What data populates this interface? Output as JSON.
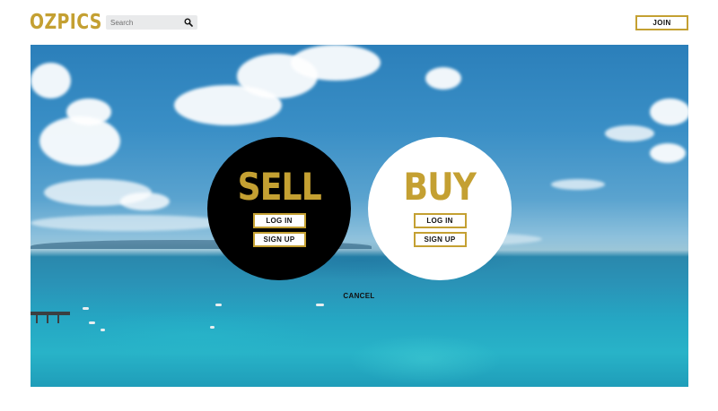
{
  "header": {
    "logo": "OZPICS",
    "search": {
      "placeholder": "Search",
      "value": ""
    },
    "join_label": "JOIN"
  },
  "modal": {
    "sell": {
      "title": "SELL",
      "login_label": "LOG IN",
      "signup_label": "SIGN UP"
    },
    "buy": {
      "title": "BUY",
      "login_label": "LOG IN",
      "signup_label": "SIGN UP"
    },
    "cancel_label": "CANCEL"
  },
  "colors": {
    "accent_gold": "#c4a032",
    "sell_circle": "#000000",
    "buy_circle": "#ffffff",
    "search_bg": "#e9eaeb"
  },
  "icons": {
    "search": "search-icon"
  }
}
